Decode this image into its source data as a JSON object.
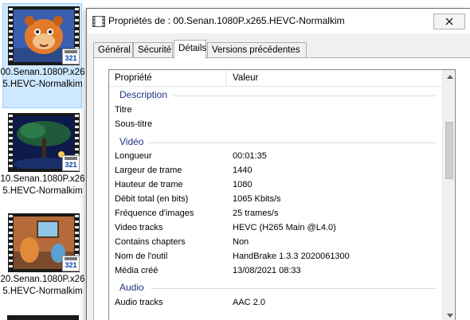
{
  "explorer": {
    "items": [
      {
        "label": "00.Senan.1080P.x265.HEVC-Normalkim",
        "selected": true,
        "badge": "321"
      },
      {
        "label": "10.Senan.1080P.x265.HEVC-Normalkim",
        "selected": false,
        "badge": "321"
      },
      {
        "label": "20.Senan.1080P.x265.HEVC-Normalkim",
        "selected": false,
        "badge": "321"
      }
    ]
  },
  "dialog": {
    "title": "Propriétés de : 00.Senan.1080P.x265.HEVC-Normalkim",
    "close_icon": "close-icon",
    "tabs": [
      {
        "label": "Général",
        "active": false
      },
      {
        "label": "Sécurité",
        "active": false
      },
      {
        "label": "Détails",
        "active": true
      },
      {
        "label": "Versions précédentes",
        "active": false
      }
    ],
    "columns": {
      "property": "Propriété",
      "value": "Valeur"
    },
    "groups": [
      {
        "label": "Description",
        "rows": [
          {
            "key": "Titre",
            "value": ""
          },
          {
            "key": "Sous-titre",
            "value": ""
          }
        ]
      },
      {
        "label": "Vidéo",
        "rows": [
          {
            "key": "Longueur",
            "value": "00:01:35"
          },
          {
            "key": "Largeur de trame",
            "value": "1440"
          },
          {
            "key": "Hauteur de trame",
            "value": "1080"
          },
          {
            "key": "Débit total (en bits)",
            "value": "1065 Kbits/s"
          },
          {
            "key": "Fréquence d'images",
            "value": "25 trames/s"
          },
          {
            "key": "Video tracks",
            "value": "HEVC (H265 Main @L4.0)"
          },
          {
            "key": "Contains chapters",
            "value": "Non"
          },
          {
            "key": "Nom de l'outil",
            "value": "HandBrake 1.3.3 2020061300"
          },
          {
            "key": "Média créé",
            "value": "13/08/2021 08:33"
          }
        ]
      },
      {
        "label": "Audio",
        "rows": [
          {
            "key": "Audio tracks",
            "value": "AAC 2.0"
          }
        ]
      }
    ]
  },
  "colors": {
    "group_label": "#1e3287",
    "selection": "#cde8ff"
  }
}
